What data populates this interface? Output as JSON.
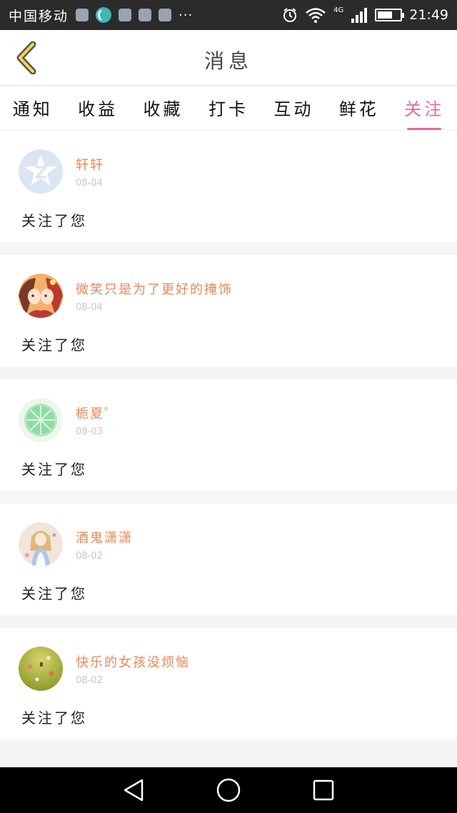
{
  "status_bar": {
    "carrier": "中国移动",
    "more": "···",
    "network": "4G",
    "time": "21:49",
    "battery_level": 0.7
  },
  "header": {
    "title": "消息",
    "back_icon": "chevron-left-icon"
  },
  "tabs": [
    {
      "label": "通知",
      "active": false
    },
    {
      "label": "收益",
      "active": false
    },
    {
      "label": "收藏",
      "active": false
    },
    {
      "label": "打卡",
      "active": false
    },
    {
      "label": "互动",
      "active": false
    },
    {
      "label": "鲜花",
      "active": false
    },
    {
      "label": "关注",
      "active": true
    }
  ],
  "colors": {
    "accent": "#e06aa1",
    "name": "#e8885a",
    "date": "#c7c7c7"
  },
  "feed": [
    {
      "name": "轩轩",
      "date": "08-04",
      "message": "关注了您",
      "avatar": "qzone-default-avatar"
    },
    {
      "name": "微笑只是为了更好的掩饰",
      "date": "08-04",
      "message": "关注了您",
      "avatar": "anime-girls-avatar"
    },
    {
      "name": "栀夏゜",
      "date": "08-03",
      "message": "关注了您",
      "avatar": "lime-slice-avatar"
    },
    {
      "name": "酒鬼潇潇",
      "date": "08-02",
      "message": "关注了您",
      "avatar": "anime-doll-avatar"
    },
    {
      "name": "快乐的女孩没烦恼",
      "date": "08-02",
      "message": "关注了您",
      "avatar": "green-field-avatar"
    }
  ],
  "nav_bar": {
    "back_icon": "triangle-back-icon",
    "home_icon": "circle-home-icon",
    "recents_icon": "square-recents-icon"
  }
}
